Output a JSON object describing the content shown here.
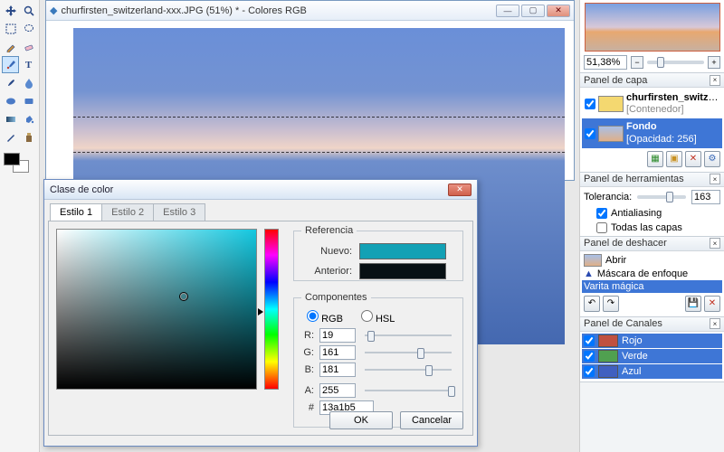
{
  "document": {
    "title": "churfirsten_switzerland-xxx.JPG (51%) * - Colores RGB"
  },
  "dialog": {
    "title": "Clase de color",
    "tabs": [
      "Estilo 1",
      "Estilo 2",
      "Estilo 3"
    ],
    "reference_legend": "Referencia",
    "new_label": "Nuevo:",
    "prev_label": "Anterior:",
    "new_color": "#13a1b5",
    "prev_color": "#081014",
    "components_legend": "Componentes",
    "mode_rgb": "RGB",
    "mode_hsl": "HSL",
    "r_label": "R:",
    "r_value": "19",
    "g_label": "G:",
    "g_value": "161",
    "b_label": "B:",
    "b_value": "181",
    "a_label": "A:",
    "a_value": "255",
    "hex_label": "#",
    "hex_value": "13a1b5",
    "ok": "OK",
    "cancel": "Cancelar"
  },
  "zoom": {
    "value": "51,38%"
  },
  "layers": {
    "title": "Panel de capa",
    "container_name": "churfirsten_switzerlan...",
    "container_sub": "[Contenedor]",
    "bg_name": "Fondo",
    "bg_opacity": "[Opacidad: 256]"
  },
  "tools_panel": {
    "title": "Panel de herramientas",
    "tolerance_label": "Tolerancia:",
    "tolerance_value": "163",
    "antialias": "Antialiasing",
    "all_layers": "Todas las capas"
  },
  "undo": {
    "title": "Panel de deshacer",
    "open": "Abrir",
    "sharpen": "Máscara de enfoque",
    "wand": "Varita mágica"
  },
  "channels": {
    "title": "Panel de Canales",
    "red": "Rojo",
    "green": "Verde",
    "blue": "Azul"
  }
}
